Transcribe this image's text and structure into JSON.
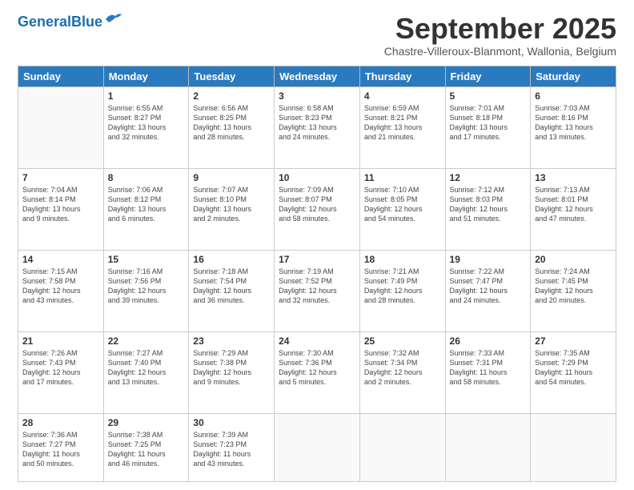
{
  "logo": {
    "text_general": "General",
    "text_blue": "Blue"
  },
  "header": {
    "month_title": "September 2025",
    "subtitle": "Chastre-Villeroux-Blanmont, Wallonia, Belgium"
  },
  "days_of_week": [
    "Sunday",
    "Monday",
    "Tuesday",
    "Wednesday",
    "Thursday",
    "Friday",
    "Saturday"
  ],
  "weeks": [
    [
      {
        "day": "",
        "info": ""
      },
      {
        "day": "1",
        "info": "Sunrise: 6:55 AM\nSunset: 8:27 PM\nDaylight: 13 hours\nand 32 minutes."
      },
      {
        "day": "2",
        "info": "Sunrise: 6:56 AM\nSunset: 8:25 PM\nDaylight: 13 hours\nand 28 minutes."
      },
      {
        "day": "3",
        "info": "Sunrise: 6:58 AM\nSunset: 8:23 PM\nDaylight: 13 hours\nand 24 minutes."
      },
      {
        "day": "4",
        "info": "Sunrise: 6:59 AM\nSunset: 8:21 PM\nDaylight: 13 hours\nand 21 minutes."
      },
      {
        "day": "5",
        "info": "Sunrise: 7:01 AM\nSunset: 8:18 PM\nDaylight: 13 hours\nand 17 minutes."
      },
      {
        "day": "6",
        "info": "Sunrise: 7:03 AM\nSunset: 8:16 PM\nDaylight: 13 hours\nand 13 minutes."
      }
    ],
    [
      {
        "day": "7",
        "info": "Sunrise: 7:04 AM\nSunset: 8:14 PM\nDaylight: 13 hours\nand 9 minutes."
      },
      {
        "day": "8",
        "info": "Sunrise: 7:06 AM\nSunset: 8:12 PM\nDaylight: 13 hours\nand 6 minutes."
      },
      {
        "day": "9",
        "info": "Sunrise: 7:07 AM\nSunset: 8:10 PM\nDaylight: 13 hours\nand 2 minutes."
      },
      {
        "day": "10",
        "info": "Sunrise: 7:09 AM\nSunset: 8:07 PM\nDaylight: 12 hours\nand 58 minutes."
      },
      {
        "day": "11",
        "info": "Sunrise: 7:10 AM\nSunset: 8:05 PM\nDaylight: 12 hours\nand 54 minutes."
      },
      {
        "day": "12",
        "info": "Sunrise: 7:12 AM\nSunset: 8:03 PM\nDaylight: 12 hours\nand 51 minutes."
      },
      {
        "day": "13",
        "info": "Sunrise: 7:13 AM\nSunset: 8:01 PM\nDaylight: 12 hours\nand 47 minutes."
      }
    ],
    [
      {
        "day": "14",
        "info": "Sunrise: 7:15 AM\nSunset: 7:58 PM\nDaylight: 12 hours\nand 43 minutes."
      },
      {
        "day": "15",
        "info": "Sunrise: 7:16 AM\nSunset: 7:56 PM\nDaylight: 12 hours\nand 39 minutes."
      },
      {
        "day": "16",
        "info": "Sunrise: 7:18 AM\nSunset: 7:54 PM\nDaylight: 12 hours\nand 36 minutes."
      },
      {
        "day": "17",
        "info": "Sunrise: 7:19 AM\nSunset: 7:52 PM\nDaylight: 12 hours\nand 32 minutes."
      },
      {
        "day": "18",
        "info": "Sunrise: 7:21 AM\nSunset: 7:49 PM\nDaylight: 12 hours\nand 28 minutes."
      },
      {
        "day": "19",
        "info": "Sunrise: 7:22 AM\nSunset: 7:47 PM\nDaylight: 12 hours\nand 24 minutes."
      },
      {
        "day": "20",
        "info": "Sunrise: 7:24 AM\nSunset: 7:45 PM\nDaylight: 12 hours\nand 20 minutes."
      }
    ],
    [
      {
        "day": "21",
        "info": "Sunrise: 7:26 AM\nSunset: 7:43 PM\nDaylight: 12 hours\nand 17 minutes."
      },
      {
        "day": "22",
        "info": "Sunrise: 7:27 AM\nSunset: 7:40 PM\nDaylight: 12 hours\nand 13 minutes."
      },
      {
        "day": "23",
        "info": "Sunrise: 7:29 AM\nSunset: 7:38 PM\nDaylight: 12 hours\nand 9 minutes."
      },
      {
        "day": "24",
        "info": "Sunrise: 7:30 AM\nSunset: 7:36 PM\nDaylight: 12 hours\nand 5 minutes."
      },
      {
        "day": "25",
        "info": "Sunrise: 7:32 AM\nSunset: 7:34 PM\nDaylight: 12 hours\nand 2 minutes."
      },
      {
        "day": "26",
        "info": "Sunrise: 7:33 AM\nSunset: 7:31 PM\nDaylight: 11 hours\nand 58 minutes."
      },
      {
        "day": "27",
        "info": "Sunrise: 7:35 AM\nSunset: 7:29 PM\nDaylight: 11 hours\nand 54 minutes."
      }
    ],
    [
      {
        "day": "28",
        "info": "Sunrise: 7:36 AM\nSunset: 7:27 PM\nDaylight: 11 hours\nand 50 minutes."
      },
      {
        "day": "29",
        "info": "Sunrise: 7:38 AM\nSunset: 7:25 PM\nDaylight: 11 hours\nand 46 minutes."
      },
      {
        "day": "30",
        "info": "Sunrise: 7:39 AM\nSunset: 7:23 PM\nDaylight: 11 hours\nand 43 minutes."
      },
      {
        "day": "",
        "info": ""
      },
      {
        "day": "",
        "info": ""
      },
      {
        "day": "",
        "info": ""
      },
      {
        "day": "",
        "info": ""
      }
    ]
  ]
}
